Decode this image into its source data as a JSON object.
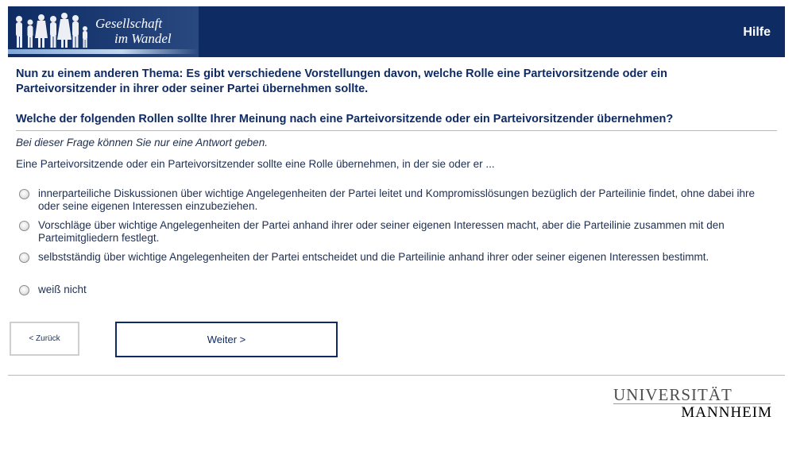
{
  "header": {
    "logo_line1": "Gesellschaft",
    "logo_line2": "im Wandel",
    "help_label": "Hilfe",
    "background": "#0e2b64"
  },
  "intro_text": "Nun zu einem anderen Thema: Es gibt verschiedene Vorstellungen davon, welche Rolle eine Parteivorsitzende oder ein Parteivorsitzender in ihrer oder seiner Partei übernehmen sollte.",
  "question_text": "Welche der folgenden Rollen sollte Ihrer Meinung nach eine Parteivorsitzende oder ein Parteivorsitzender übernehmen?",
  "instruction_text": "Bei dieser Frage können Sie nur eine Antwort geben.",
  "stem_text": "Eine Parteivorsitzende oder ein Parteivorsitzender sollte eine Rolle übernehmen, in der sie oder er ...",
  "options": [
    {
      "label": "innerparteiliche Diskussionen über wichtige Angelegenheiten der Partei leitet und Kompromisslösungen bezüglich der Parteilinie findet, ohne dabei ihre oder seine eigenen Interessen einzubeziehen.",
      "selected": false
    },
    {
      "label": "Vorschläge über wichtige Angelegenheiten der Partei anhand ihrer oder seiner eigenen Interessen macht, aber die Parteilinie zusammen mit den Parteimitgliedern festlegt.",
      "selected": false
    },
    {
      "label": "selbstständig über wichtige Angelegenheiten der Partei entscheidet und die Parteilinie anhand ihrer oder seiner eigenen Interessen bestimmt.",
      "selected": false
    },
    {
      "label": "weiß nicht",
      "selected": false
    }
  ],
  "nav": {
    "back_label": "< Zurück",
    "next_label": "Weiter >"
  },
  "footer": {
    "uni_line1": "UNIVERSITÄT",
    "uni_line2": "MANNHEIM"
  },
  "colors": {
    "accent": "#0e2b64",
    "divider": "#b9b9b9"
  }
}
